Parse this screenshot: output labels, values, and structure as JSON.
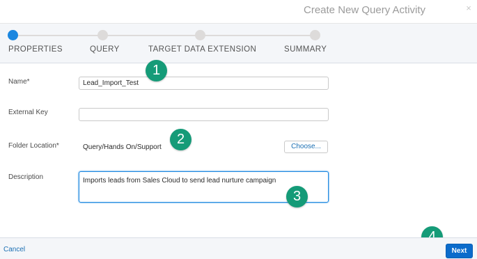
{
  "dialog": {
    "title": "Create New Query Activity",
    "close_icon": "×"
  },
  "steps": [
    {
      "label": "PROPERTIES",
      "active": true
    },
    {
      "label": "QUERY",
      "active": false
    },
    {
      "label": "TARGET DATA EXTENSION",
      "active": false
    },
    {
      "label": "SUMMARY",
      "active": false
    }
  ],
  "form": {
    "name_label": "Name*",
    "name_value": "Lead_Import_Test",
    "external_key_label": "External Key",
    "external_key_value": "",
    "folder_label": "Folder Location*",
    "folder_value": "Query/Hands On/Support",
    "choose_button": "Choose...",
    "description_label": "Description",
    "description_value": "Imports leads from Sales Cloud to send lead nurture campaign"
  },
  "callouts": [
    "1",
    "2",
    "3",
    "4"
  ],
  "footer": {
    "cancel_label": "Cancel",
    "next_label": "Next"
  },
  "colors": {
    "accent": "#1b87e0",
    "primary_button": "#0b6bcb",
    "callout_badge": "#159b78",
    "link": "#1b6fb3"
  }
}
